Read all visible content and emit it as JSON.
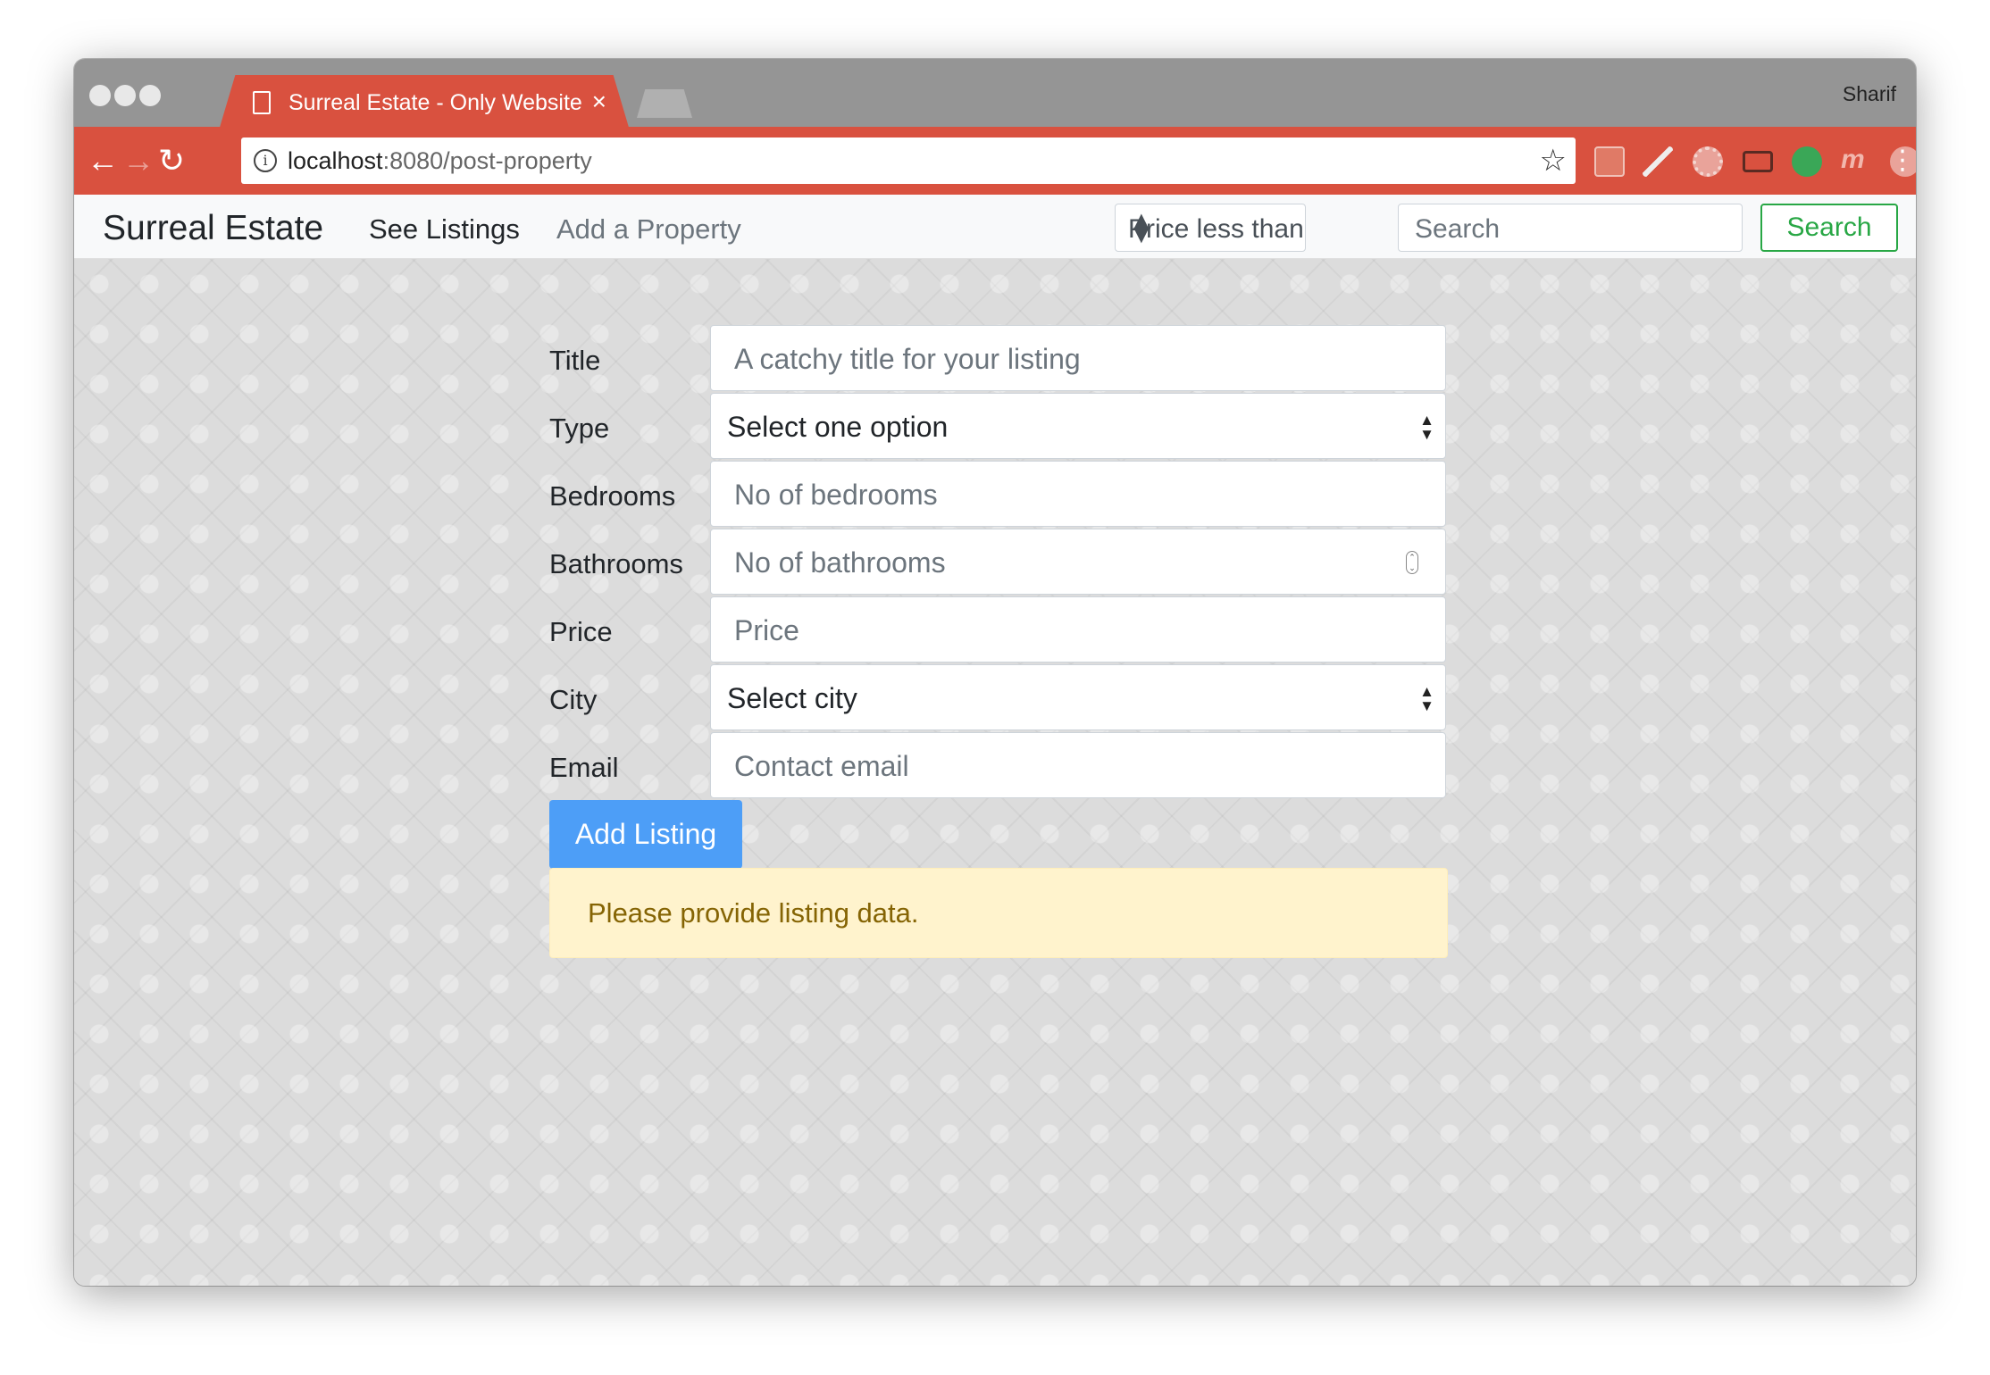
{
  "browser": {
    "tab_title": "Surreal Estate - Only Website \\",
    "tab_close": "×",
    "profile_name": "Sharif",
    "url_host": "localhost",
    "url_path": ":8080/post-property",
    "back_glyph": "←",
    "forward_glyph": "→",
    "reload_glyph": "↻",
    "star_glyph": "☆",
    "menu_glyph": "⋮",
    "info_glyph": "i"
  },
  "navbar": {
    "brand": "Surreal Estate",
    "links": [
      "See Listings",
      "Add a Property"
    ],
    "price_filter": "Price less than",
    "search_placeholder": "Search",
    "search_button": "Search"
  },
  "form": {
    "fields": [
      {
        "label": "Title",
        "placeholder": "A catchy title for your listing",
        "kind": "text"
      },
      {
        "label": "Type",
        "value": "Select one option",
        "kind": "select"
      },
      {
        "label": "Bedrooms",
        "placeholder": "No of bedrooms",
        "kind": "text"
      },
      {
        "label": "Bathrooms",
        "placeholder": "No of bathrooms",
        "kind": "number"
      },
      {
        "label": "Price",
        "placeholder": "Price",
        "kind": "text"
      },
      {
        "label": "City",
        "value": "Select city",
        "kind": "select"
      },
      {
        "label": "Email",
        "placeholder": "Contact email",
        "kind": "text"
      }
    ],
    "submit_label": "Add Listing",
    "alert_message": "Please provide listing data."
  },
  "colors": {
    "chrome_accent": "#d9513f",
    "primary_button": "#4d9ef7",
    "success_outline": "#28a745",
    "alert_bg": "#fff3cd",
    "alert_text": "#856404"
  },
  "icons": [
    "document-icon",
    "close-icon",
    "back-arrow-icon",
    "forward-arrow-icon",
    "reload-icon",
    "info-icon",
    "star-icon",
    "extension-icons",
    "menu-icon"
  ]
}
